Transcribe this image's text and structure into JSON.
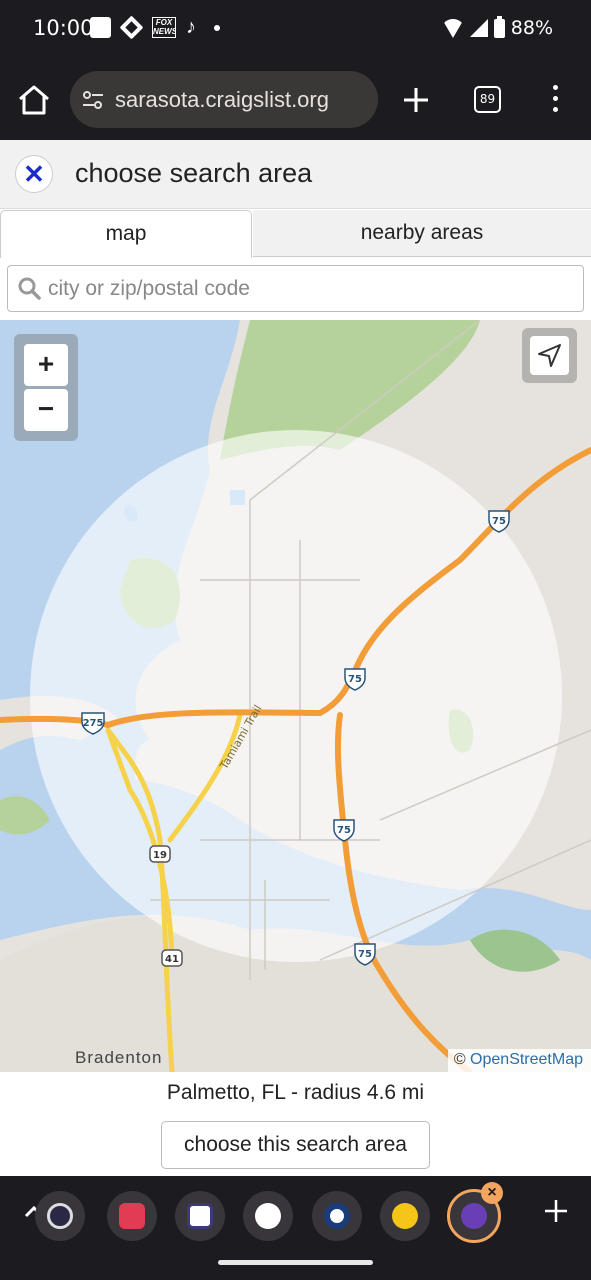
{
  "status_bar": {
    "time": "10:00",
    "battery": "88%",
    "fox_label": "FOX NEWS",
    "icons": [
      "square-icon",
      "chase-icon",
      "fox-news-icon",
      "tiktok-icon",
      "dot-icon",
      "wifi-icon",
      "signal-icon",
      "battery-icon"
    ]
  },
  "browser": {
    "url": "sarasota.craigslist.org",
    "tab_count": "89"
  },
  "header": {
    "close_glyph": "✕",
    "title": "choose search area"
  },
  "tabs": {
    "map": "map",
    "nearby": "nearby areas"
  },
  "search": {
    "placeholder": "city or zip/postal code",
    "value": ""
  },
  "map": {
    "zoom_in": "+",
    "zoom_out": "−",
    "place_label": "Bradenton",
    "road_label": "Tamiami Trail",
    "shields": [
      "275",
      "75",
      "75",
      "75",
      "75",
      "19",
      "41"
    ],
    "attribution_prefix": "© ",
    "attribution_link": "OpenStreetMap"
  },
  "selection": {
    "area_text": "Palmetto, FL - radius 4.6 mi",
    "button": "choose this search area"
  },
  "colors": {
    "water": "#b9d3ee",
    "land": "#e6e3de",
    "park": "#b5d29b",
    "interstate": "#f29d38",
    "highway": "#f5d24a",
    "accent": "#f3a45e"
  }
}
